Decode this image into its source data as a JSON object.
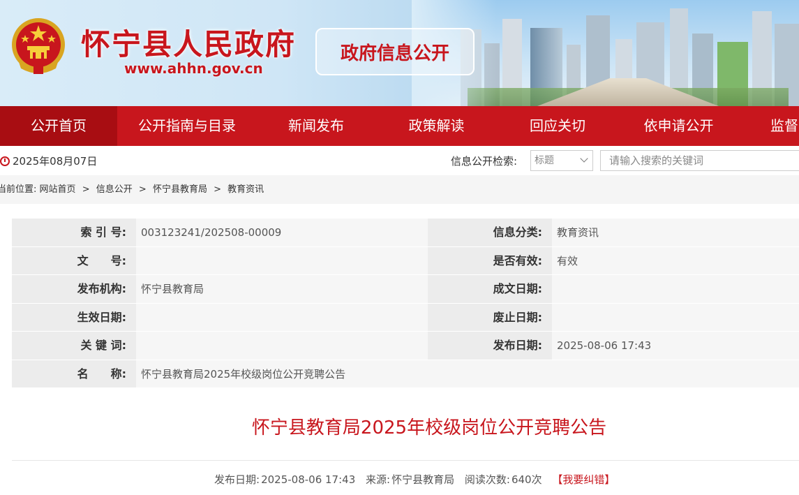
{
  "header": {
    "site_title": "怀宁县人民政府",
    "site_url": "www.ahhn.gov.cn",
    "section_badge": "政府信息公开"
  },
  "nav": {
    "items": [
      {
        "label": "公开首页",
        "active": true
      },
      {
        "label": "公开指南与目录"
      },
      {
        "label": "新闻发布"
      },
      {
        "label": "政策解读"
      },
      {
        "label": "回应关切"
      },
      {
        "label": "依申请公开"
      },
      {
        "label": "监督"
      }
    ]
  },
  "toolbar": {
    "date": "2025年08月07日",
    "search_label": "信息公开检索:",
    "search_type": "标题",
    "search_placeholder": "请输入搜索的关键词"
  },
  "breadcrumb": {
    "prefix": "当前位置:",
    "items": [
      "网站首页",
      "信息公开",
      "怀宁县教育局",
      "教育资讯"
    ],
    "separator": ">"
  },
  "meta": {
    "index_no_label": "索 引 号:",
    "index_no": "003123241/202508-00009",
    "category_label": "信息分类:",
    "category": "教育资讯",
    "doc_no_label": "文　　号:",
    "doc_no": "",
    "valid_label": "是否有效:",
    "valid": "有效",
    "publisher_label": "发布机构:",
    "publisher": "怀宁县教育局",
    "written_date_label": "成文日期:",
    "written_date": "",
    "effective_date_label": "生效日期:",
    "effective_date": "",
    "abolish_date_label": "废止日期:",
    "abolish_date": "",
    "keywords_label": "关 键 词:",
    "keywords": "",
    "publish_date_label": "发布日期:",
    "publish_date": "2025-08-06 17:43",
    "name_label": "名　　称:",
    "name": "怀宁县教育局2025年校级岗位公开竞聘公告"
  },
  "article": {
    "title": "怀宁县教育局2025年校级岗位公开竞聘公告",
    "publish_label": "发布日期:",
    "publish_date": "2025-08-06 17:43",
    "source_label": "来源:",
    "source": "怀宁县教育局",
    "views_label": "阅读次数:",
    "views": "640次",
    "report_link": "【我要纠错】"
  },
  "colors": {
    "brand_red": "#c8161d",
    "nav_active": "#a80d12"
  }
}
